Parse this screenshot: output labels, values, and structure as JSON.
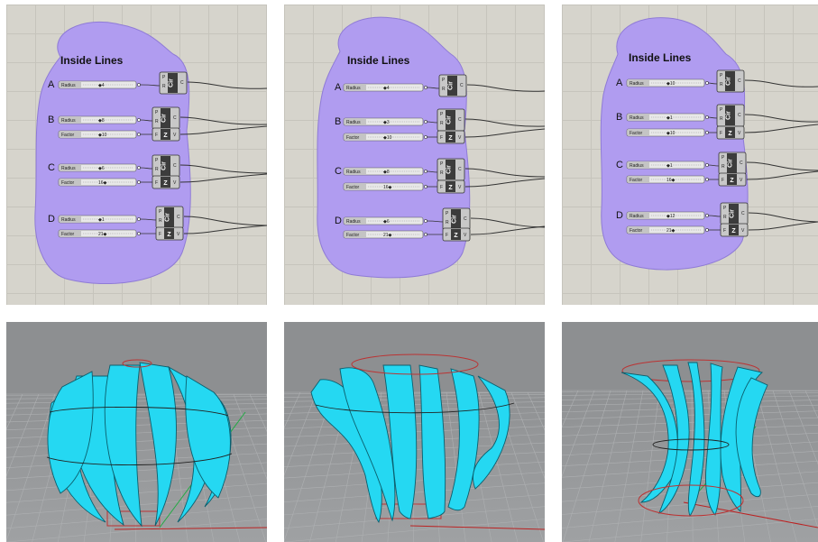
{
  "definition_panels": [
    {
      "group_title": "Inside Lines",
      "rows": [
        {
          "label": "A",
          "params": [
            {
              "name": "Radius",
              "value": "◆4"
            }
          ]
        },
        {
          "label": "B",
          "params": [
            {
              "name": "Radius",
              "value": "◆8"
            },
            {
              "name": "Factor",
              "value": "◆10"
            }
          ]
        },
        {
          "label": "C",
          "params": [
            {
              "name": "Radius",
              "value": "◆6"
            },
            {
              "name": "Factor",
              "value": "16◆"
            }
          ]
        },
        {
          "label": "D",
          "params": [
            {
              "name": "Radius",
              "value": "◆1"
            },
            {
              "name": "Factor",
              "value": "21◆"
            }
          ]
        }
      ]
    },
    {
      "group_title": "Inside Lines",
      "rows": [
        {
          "label": "A",
          "params": [
            {
              "name": "Radius",
              "value": "◆4"
            }
          ]
        },
        {
          "label": "B",
          "params": [
            {
              "name": "Radius",
              "value": "◆3"
            },
            {
              "name": "Factor",
              "value": "◆10"
            }
          ]
        },
        {
          "label": "C",
          "params": [
            {
              "name": "Radius",
              "value": "◆8"
            },
            {
              "name": "Factor",
              "value": "16◆"
            }
          ]
        },
        {
          "label": "D",
          "params": [
            {
              "name": "Radius",
              "value": "◆6"
            },
            {
              "name": "Factor",
              "value": "21◆"
            }
          ]
        }
      ]
    },
    {
      "group_title": "Inside Lines",
      "rows": [
        {
          "label": "A",
          "params": [
            {
              "name": "Radius",
              "value": "◆10"
            }
          ]
        },
        {
          "label": "B",
          "params": [
            {
              "name": "Radius",
              "value": "◆1"
            },
            {
              "name": "Factor",
              "value": "◆10"
            }
          ]
        },
        {
          "label": "C",
          "params": [
            {
              "name": "Radius",
              "value": "◆1"
            },
            {
              "name": "Factor",
              "value": "16◆"
            }
          ]
        },
        {
          "label": "D",
          "params": [
            {
              "name": "Radius",
              "value": "◆12"
            },
            {
              "name": "Factor",
              "value": "21◆"
            }
          ]
        }
      ]
    }
  ],
  "component_ports": {
    "circle_in": [
      "P",
      "R"
    ],
    "circle_out": "C",
    "vector_in": "F",
    "vector_out": "V"
  },
  "component_icons": {
    "circle": "Cir",
    "vector": "Z"
  },
  "colors": {
    "group_fill": "#b09cf0",
    "model_fill": "#25d8f2",
    "canvas_bg": "#d6d4cc",
    "viewport_bg": "#9a9c9e"
  },
  "viewport_icons": [
    "vase-model-1",
    "vase-model-2",
    "vase-model-3"
  ]
}
